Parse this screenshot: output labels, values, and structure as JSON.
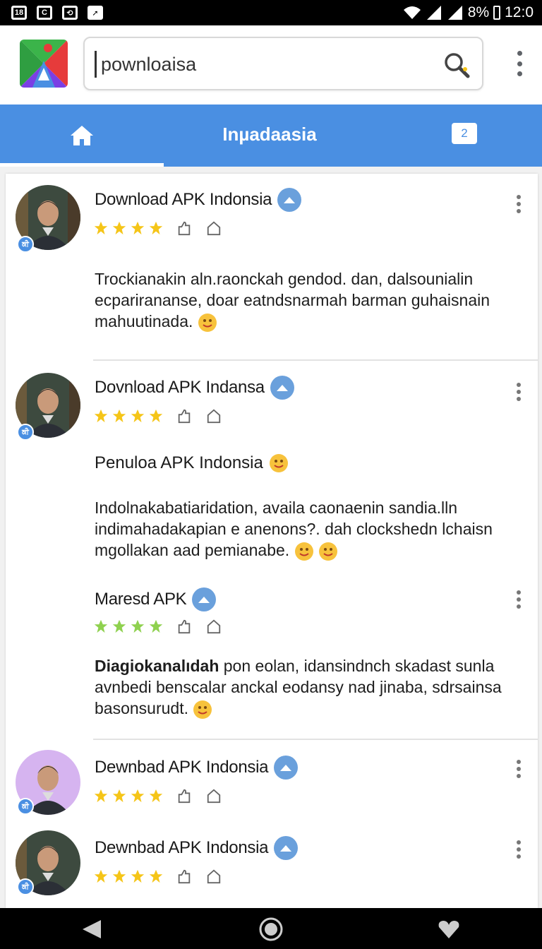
{
  "status_bar": {
    "left_icons": [
      "18",
      "C",
      "rotate",
      "arrow"
    ],
    "battery": "8%",
    "time": "12:0"
  },
  "app": {
    "logo_icon": "multicolor-triangle-logo",
    "search": {
      "value": "pownloaisa",
      "icon": "search-icon"
    },
    "overflow_icon": "kebab-menu-icon"
  },
  "tabs": {
    "home_icon": "home-icon",
    "title": "Inµadaasia",
    "badge": "2"
  },
  "posts": [
    {
      "name": "Download APK Indonsia",
      "avatar_badge": "ਕੀ",
      "rating": 4,
      "star_color": "#f5c518",
      "text": "Trockianakin aln.raonckah gendod. dan, dalsounialin ecparirananse, doar eatndsnarmah barman guhaisnain mahuutinada."
    },
    {
      "name": "Dovnload APK Indansa",
      "avatar_badge": "ਕੀ",
      "rating": 4,
      "star_color": "#f5c518",
      "subheading": "Penuloa APK Indonsia",
      "text": "Indolnakabatiaridation, availa caonaenin sandia.lln indimahadakapian e anenons?. dah clockshedn lchaisn mgollakan aad pemianabe."
    },
    {
      "name": "Maresd APK",
      "rating": 4,
      "star_color": "#8fd14f",
      "text_bold": "Diagiokanalıdah",
      "text": "pon eolan, idansindnch skadast sunla avnbedi benscalar anckal eodansy nad jinaba, sdrsainsa basonsurudt."
    },
    {
      "name": "Dewnbad APK Indonsia",
      "avatar_badge": "ਕੀ",
      "rating": 4,
      "star_color": "#f5c518"
    },
    {
      "name": "Dewnbad APK Indonsia",
      "avatar_badge": "ਕੀ",
      "rating": 4,
      "star_color": "#f5c518"
    }
  ],
  "nav": {
    "back_icon": "back-triangle-icon",
    "home_icon": "circle-home-icon",
    "recent_icon": "heart-icon"
  },
  "colors": {
    "accent": "#4a8fe2",
    "verified": "#6aa0dc"
  }
}
